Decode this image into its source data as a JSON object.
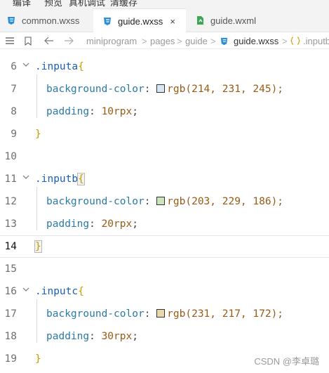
{
  "menu": {
    "items": [
      "编译",
      "预览",
      "真机调试",
      "清缓存"
    ]
  },
  "tabs": [
    {
      "label": "common.wxss",
      "icon": "css-file-icon",
      "active": false
    },
    {
      "label": "guide.wxss",
      "icon": "css-file-icon",
      "active": true,
      "close": "×"
    },
    {
      "label": "guide.wxml",
      "icon": "wxml-file-icon",
      "active": false
    }
  ],
  "breadcrumb": {
    "items": [
      "miniprogram",
      "pages",
      "guide",
      "guide.wxss",
      ".inputb"
    ],
    "separator": ">"
  },
  "colors": {
    "inputa": "#d6e7f5",
    "inputb": "#cbe5ba",
    "inputc": "#e7d9ac",
    "selector": "#1a5fb4",
    "property": "#2a7aa8",
    "value": "#9a5a16",
    "brace": "#c79a00"
  },
  "editor": {
    "lines": [
      {
        "n": "6",
        "selector": ".inputa",
        "open": "{"
      },
      {
        "n": "7",
        "prop": "background-color",
        "fn": "rgb",
        "args": "(214, 231, 245);"
      },
      {
        "n": "8",
        "prop": "padding",
        "num": "10",
        "unit": "rpx",
        "end": ";"
      },
      {
        "n": "9",
        "close": "}"
      },
      {
        "n": "10"
      },
      {
        "n": "11",
        "selector": ".inputb",
        "open": "{"
      },
      {
        "n": "12",
        "prop": "background-color",
        "fn": "rgb",
        "args": "(203, 229, 186);"
      },
      {
        "n": "13",
        "prop": "padding",
        "num": "20",
        "unit": "rpx",
        "end": ";"
      },
      {
        "n": "14",
        "close": "}"
      },
      {
        "n": "15"
      },
      {
        "n": "16",
        "selector": ".inputc",
        "open": "{"
      },
      {
        "n": "17",
        "prop": "background-color",
        "fn": "rgb",
        "args": "(231, 217, 172);"
      },
      {
        "n": "18",
        "prop": "padding",
        "num": "30",
        "unit": "rpx",
        "end": ";"
      },
      {
        "n": "19",
        "close": "}"
      }
    ]
  },
  "watermark": "CSDN @李卓璐"
}
